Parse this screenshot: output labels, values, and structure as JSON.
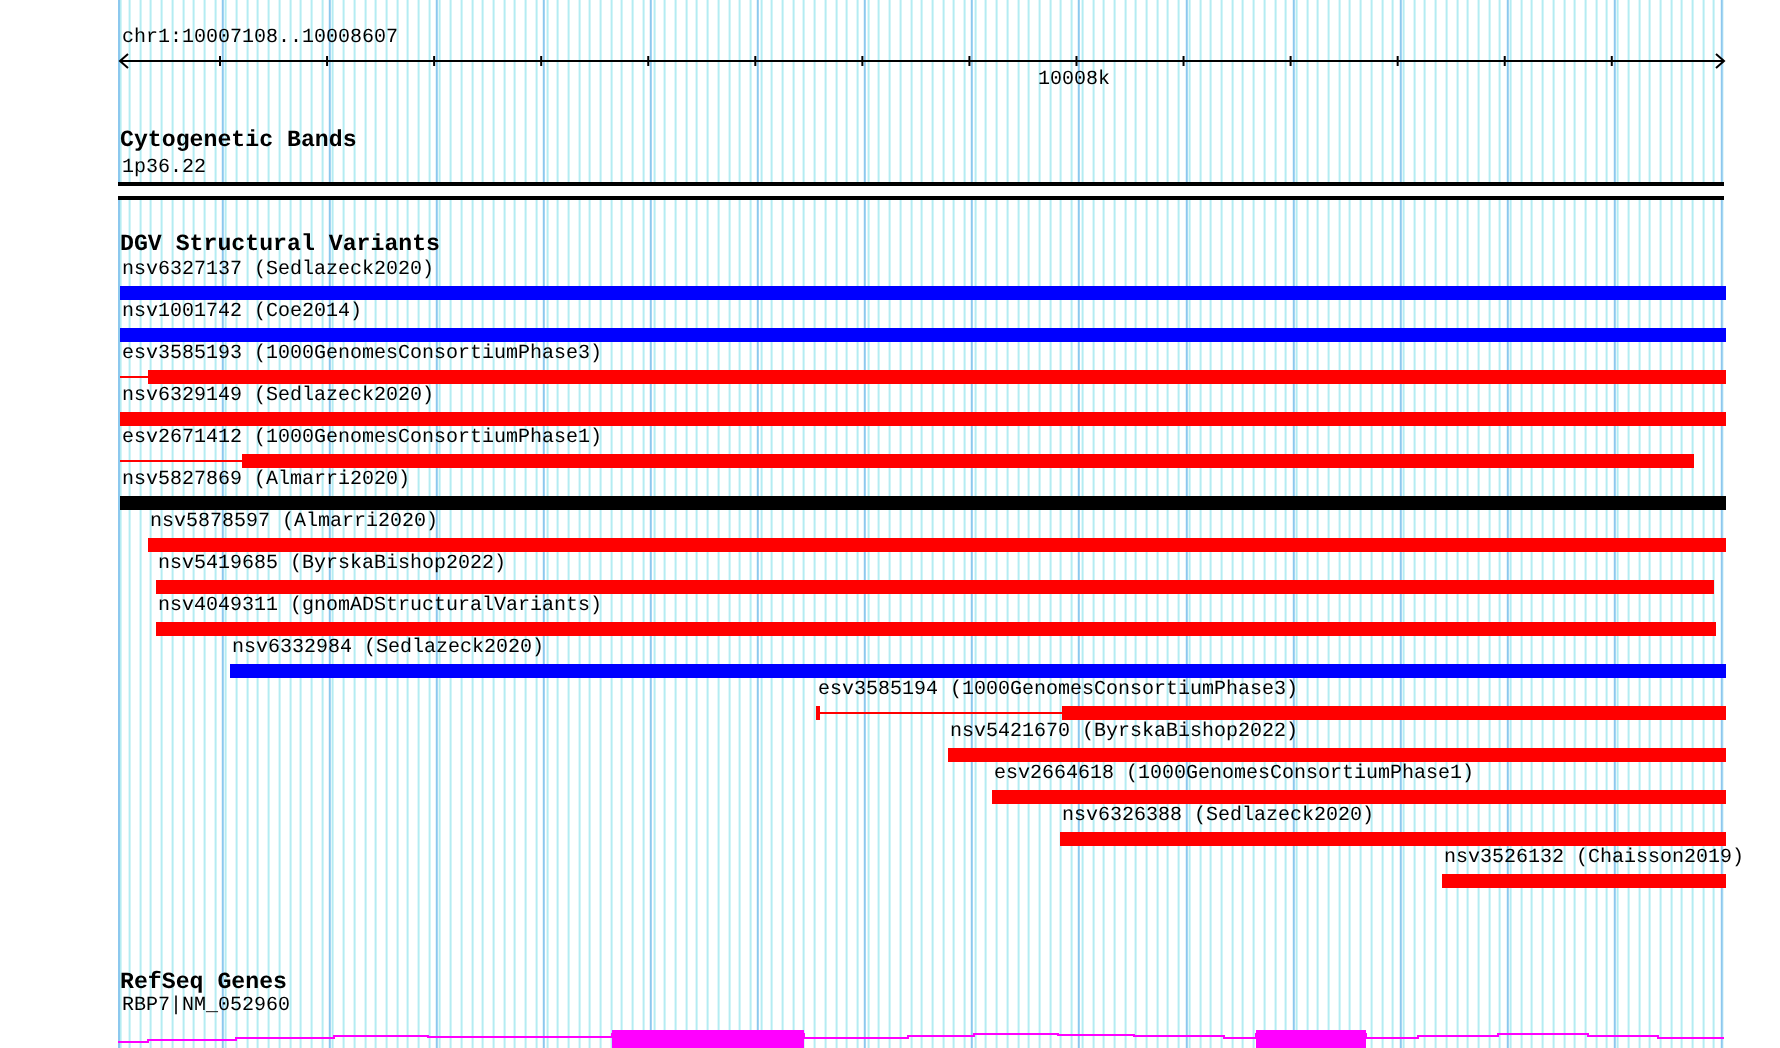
{
  "ruler": {
    "location": "chr1:10007108..10008607",
    "tick_labels": [
      "10008k"
    ]
  },
  "tracks": [
    {
      "kind": "cytoband",
      "title": "Cytogenetic Bands",
      "items": [
        "1p36.22"
      ]
    },
    {
      "kind": "variants",
      "title": "DGV Structural Variants",
      "features": [
        {
          "name": "nsv6327137 (Sedlazeck2020)",
          "color": "#0000ff"
        },
        {
          "name": "nsv1001742 (Coe2014)",
          "color": "#0000ff"
        },
        {
          "name": "esv3585193 (1000GenomesConsortiumPhase3)",
          "color": "#ff0000"
        },
        {
          "name": "nsv6329149 (Sedlazeck2020)",
          "color": "#ff0000"
        },
        {
          "name": "esv2671412 (1000GenomesConsortiumPhase1)",
          "color": "#ff0000"
        },
        {
          "name": "nsv5827869 (Almarri2020)",
          "color": "#000000"
        },
        {
          "name": "nsv5878597 (Almarri2020)",
          "color": "#ff0000"
        },
        {
          "name": "nsv5419685 (ByrskaBishop2022)",
          "color": "#ff0000"
        },
        {
          "name": "nsv4049311 (gnomADStructuralVariants)",
          "color": "#ff0000"
        },
        {
          "name": "nsv6332984 (Sedlazeck2020)",
          "color": "#0000ff"
        },
        {
          "name": "esv3585194 (1000GenomesConsortiumPhase3)",
          "color": "#ff0000"
        },
        {
          "name": "nsv5421670 (ByrskaBishop2022)",
          "color": "#ff0000"
        },
        {
          "name": "esv2664618 (1000GenomesConsortiumPhase1)",
          "color": "#ff0000"
        },
        {
          "name": "nsv6326388 (Sedlazeck2020)",
          "color": "#ff0000"
        },
        {
          "name": "nsv3526132 (Chaisson2019)",
          "color": "#ff0000"
        }
      ]
    },
    {
      "kind": "gene",
      "title": "RefSeq Genes",
      "items": [
        "RBP7|NM_052960"
      ]
    }
  ]
}
